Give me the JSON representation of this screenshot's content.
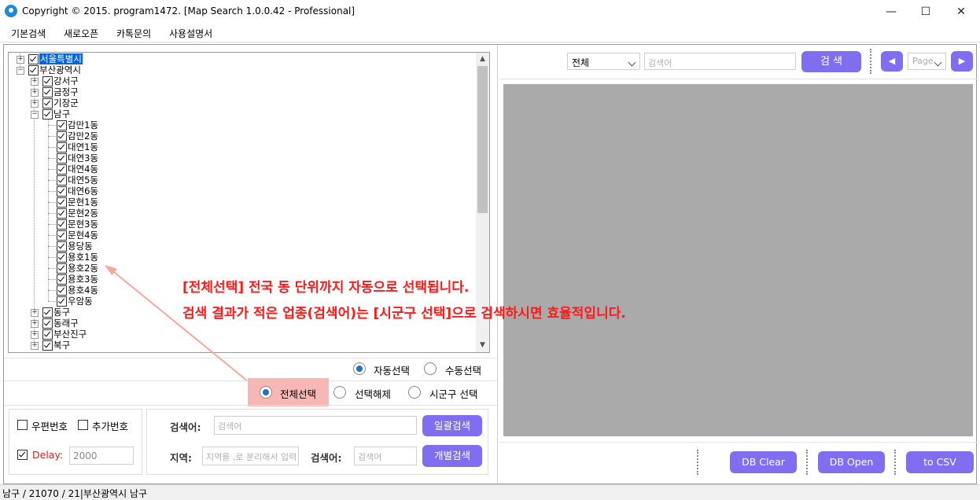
{
  "window": {
    "title": "Copyright © 2015. program1472. [Map Search 1.0.0.42 - Professional]",
    "controls": {
      "minimize": "—",
      "maximize": "☐",
      "close": "✕"
    }
  },
  "menu": [
    "기본검색",
    "새로오픈",
    "카톡문의",
    "사용설명서"
  ],
  "tree": {
    "items": [
      {
        "label": "서울특별시",
        "level": 0,
        "exp": "+",
        "selected": true
      },
      {
        "label": "부산광역시",
        "level": 0,
        "exp": "−"
      },
      {
        "label": "강서구",
        "level": 1,
        "exp": "+"
      },
      {
        "label": "금정구",
        "level": 1,
        "exp": "+"
      },
      {
        "label": "기장군",
        "level": 1,
        "exp": "+"
      },
      {
        "label": "남구",
        "level": 1,
        "exp": "−"
      },
      {
        "label": "감만1동",
        "level": 2
      },
      {
        "label": "감만2동",
        "level": 2
      },
      {
        "label": "대연1동",
        "level": 2
      },
      {
        "label": "대연3동",
        "level": 2
      },
      {
        "label": "대연4동",
        "level": 2
      },
      {
        "label": "대연5동",
        "level": 2
      },
      {
        "label": "대연6동",
        "level": 2
      },
      {
        "label": "문현1동",
        "level": 2
      },
      {
        "label": "문현2동",
        "level": 2
      },
      {
        "label": "문현3동",
        "level": 2
      },
      {
        "label": "문현4동",
        "level": 2
      },
      {
        "label": "용당동",
        "level": 2
      },
      {
        "label": "용호1동",
        "level": 2
      },
      {
        "label": "용호2동",
        "level": 2
      },
      {
        "label": "용호3동",
        "level": 2
      },
      {
        "label": "용호4동",
        "level": 2
      },
      {
        "label": "우암동",
        "level": 2
      },
      {
        "label": "동구",
        "level": 1,
        "exp": "+"
      },
      {
        "label": "동래구",
        "level": 1,
        "exp": "+"
      },
      {
        "label": "부산진구",
        "level": 1,
        "exp": "+"
      },
      {
        "label": "북구",
        "level": 1,
        "exp": "+"
      }
    ]
  },
  "selection_mode": {
    "auto": "자동선택",
    "manual": "수동선택",
    "selected": "auto"
  },
  "selection_scope": {
    "all": "전체선택",
    "clear": "선택해제",
    "district": "시군구 선택",
    "selected": "all"
  },
  "options": {
    "postal_label": "우편번호",
    "extra_label": "추가번호",
    "delay_label": "Delay:",
    "delay_value": "2000",
    "delay_checked": true
  },
  "search": {
    "keyword_label": "검색어:",
    "keyword_placeholder": "검색어",
    "bulk_button": "일괄검색",
    "region_label": "지역:",
    "region_placeholder": "지역을 ,로 분리해서 입력",
    "keyword2_label": "검색어:",
    "keyword2_placeholder": "검색어",
    "individual_button": "개별검색"
  },
  "right_top": {
    "category_value": "전체",
    "search_placeholder": "검색어",
    "search_button": "검  색",
    "prev_icon": "◀",
    "page_value": "Page",
    "next_icon": "▶"
  },
  "right_bottom": {
    "db_clear": "DB Clear",
    "db_open": "DB Open",
    "to_csv": "to CSV"
  },
  "annotation": {
    "line1": "[전체선택] 전국 동 단위까지 자동으로 선택됩니다.",
    "line2": "검색 결과가 적은 업종(검색어)는 [시군구 선택]으로 검색하시면 효율적입니다."
  },
  "status": "남구 / 21070 / 21|부산광역시 남구",
  "colors": {
    "accent": "#7f6ff0",
    "annotation": "#ff1a1a",
    "highlight": "#f7b8b5",
    "map_bg": "#aaaaaa"
  }
}
